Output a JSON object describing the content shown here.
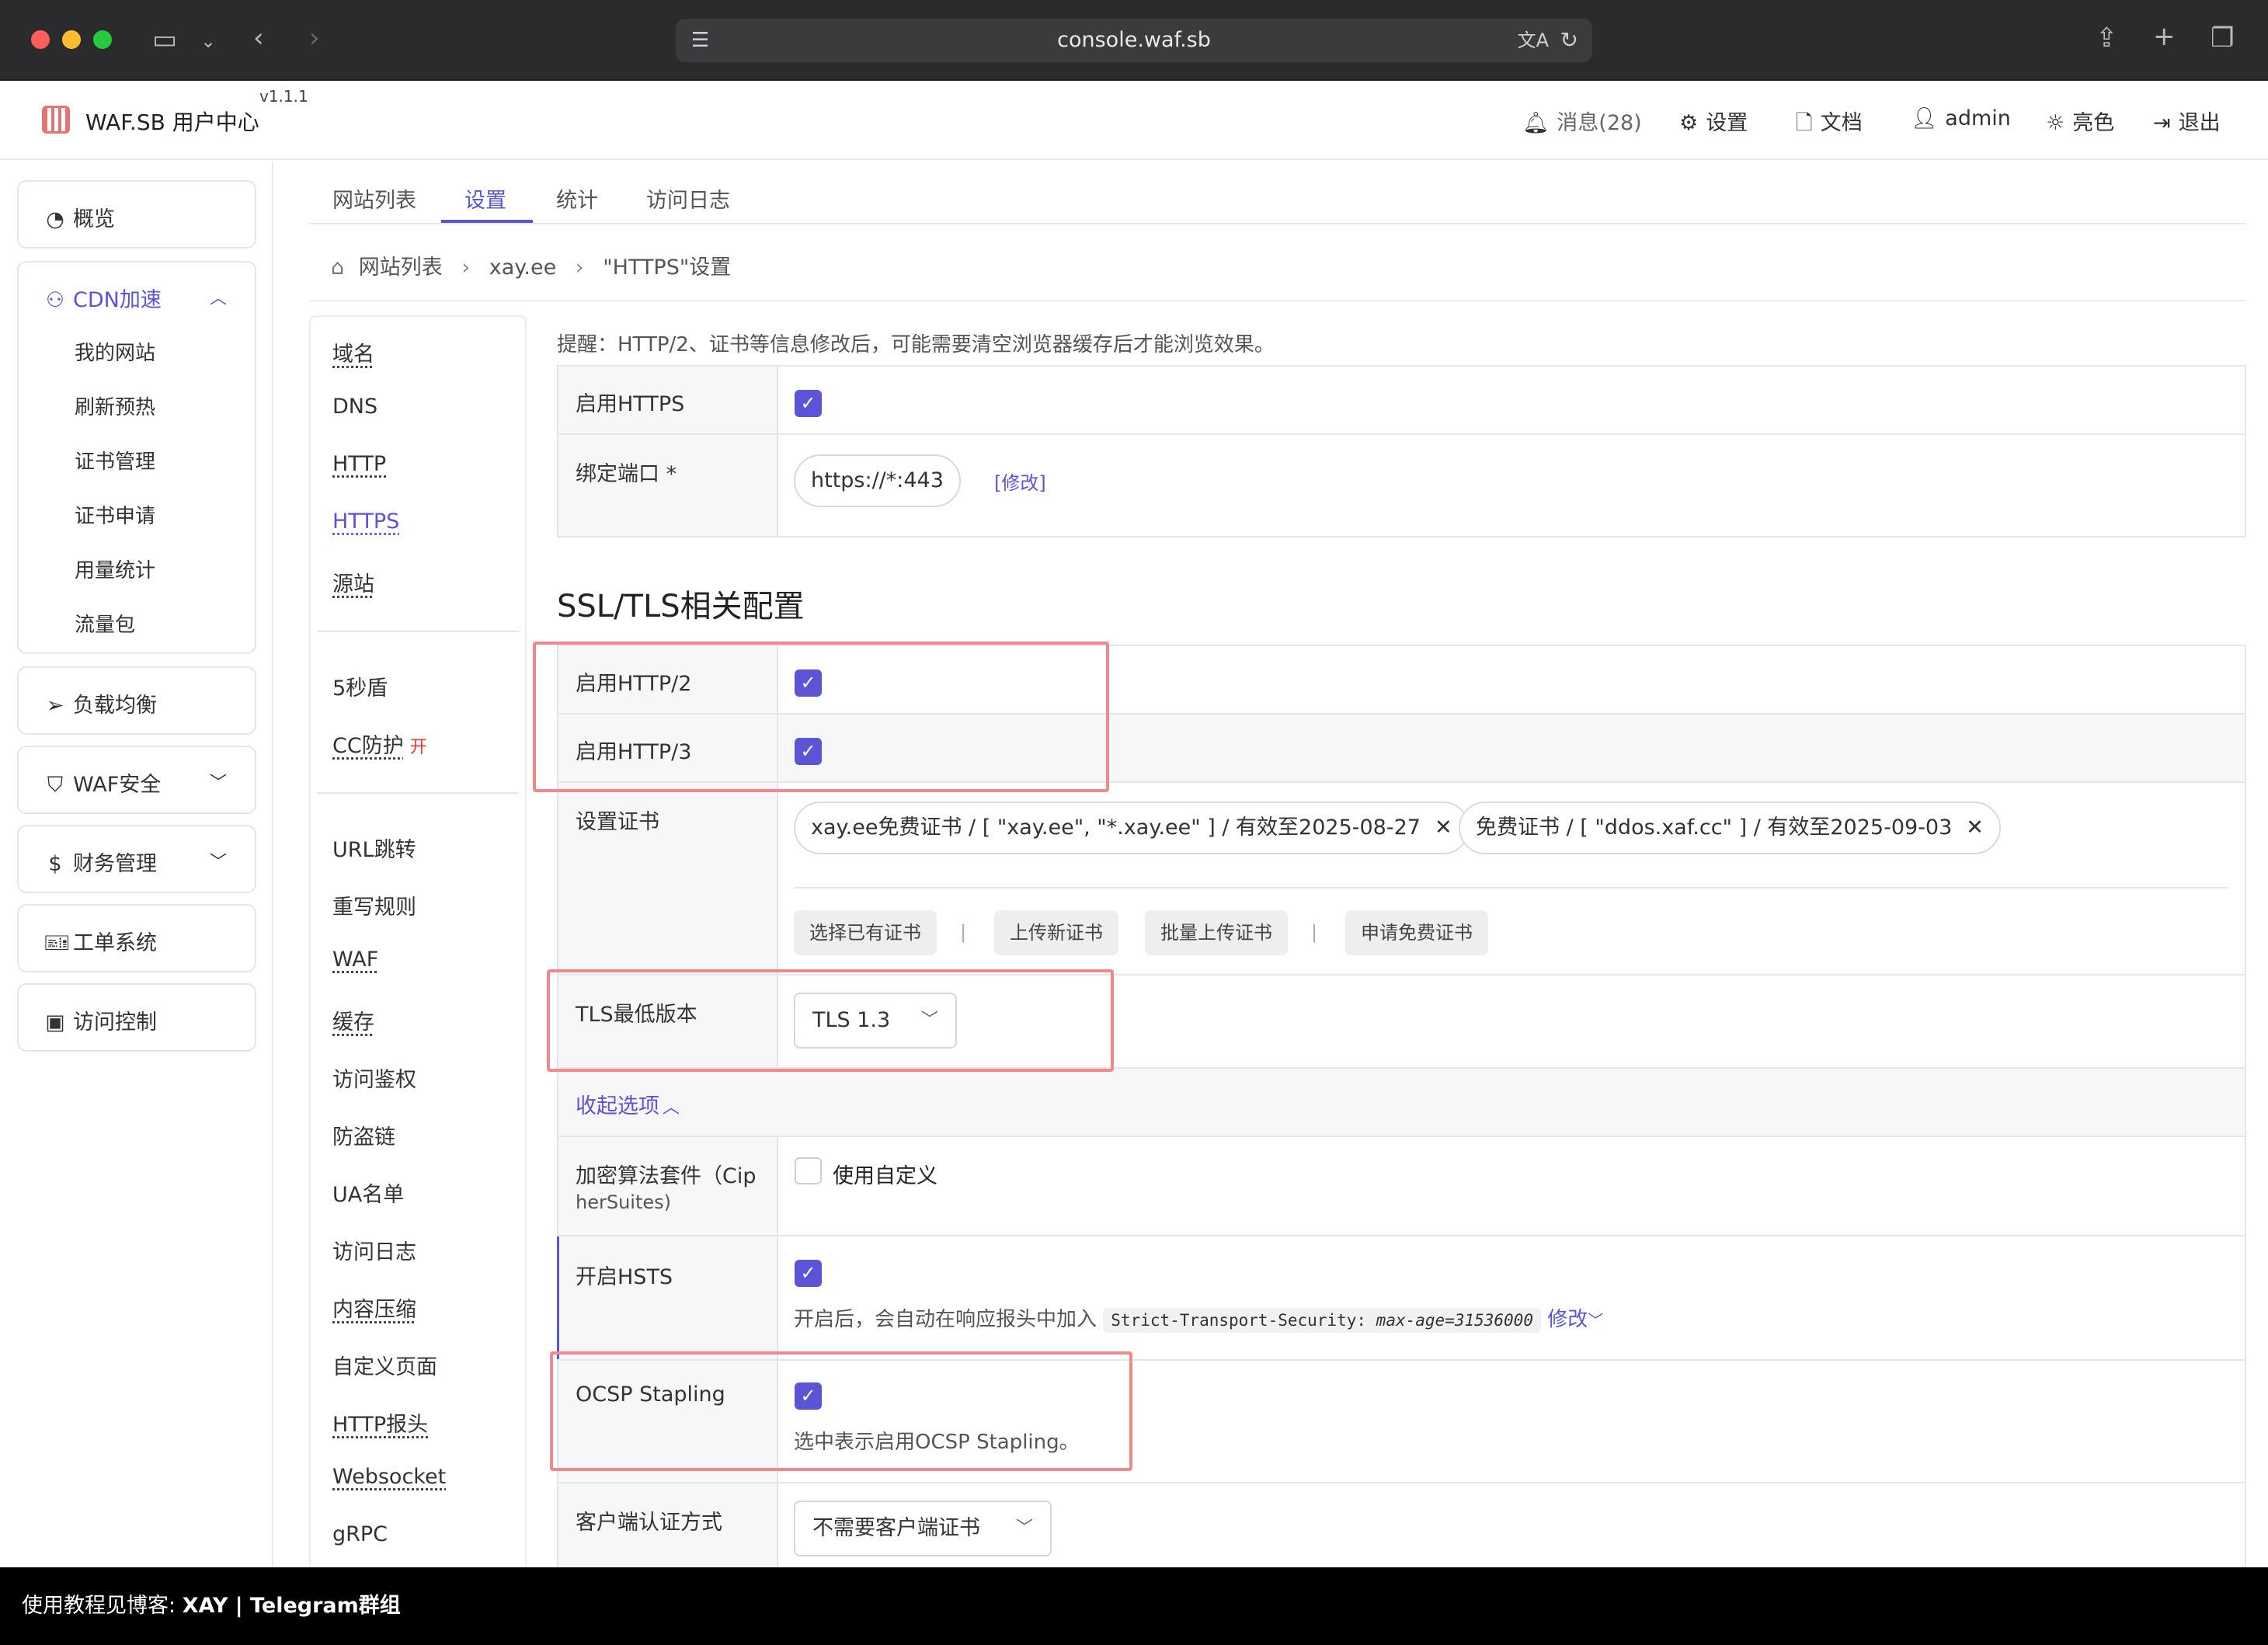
{
  "browser": {
    "url": "console.waf.sb"
  },
  "header": {
    "app_title": "WAF.SB 用户中心",
    "version": "v1.1.1",
    "messages": "消息(28)",
    "settings": "设置",
    "docs": "文档",
    "user": "admin",
    "theme": "亮色",
    "logout": "退出"
  },
  "sidebar": {
    "overview": "概览",
    "cdn": "CDN加速",
    "cdn_items": [
      "我的网站",
      "刷新预热",
      "证书管理",
      "证书申请",
      "用量统计",
      "流量包"
    ],
    "load_balance": "负载均衡",
    "waf": "WAF安全",
    "finance": "财务管理",
    "ticket": "工单系统",
    "access": "访问控制"
  },
  "tabs": [
    "网站列表",
    "设置",
    "统计",
    "访问日志"
  ],
  "breadcrumb": [
    "网站列表",
    "xay.ee",
    "\"HTTPS\"设置"
  ],
  "subnav": {
    "group1": [
      "域名",
      "DNS",
      "HTTP",
      "HTTPS",
      "源站"
    ],
    "group2_a": "5秒盾",
    "group2_b": "CC防护",
    "cc_tag": "开",
    "group3": [
      "URL跳转",
      "重写规则",
      "WAF",
      "缓存",
      "访问鉴权",
      "防盗链",
      "UA名单",
      "访问日志",
      "内容压缩",
      "自定义页面",
      "HTTP报头",
      "Websocket",
      "gRPC"
    ]
  },
  "notice": "提醒：HTTP/2、证书等信息修改后，可能需要清空浏览器缓存后才能浏览效果。",
  "https": {
    "enable_label": "启用HTTPS",
    "port_label": "绑定端口 *",
    "port_value": "https://*:443",
    "port_edit": "[修改]"
  },
  "ssl": {
    "title": "SSL/TLS相关配置",
    "http2_label": "启用HTTP/2",
    "http3_label": "启用HTTP/3",
    "cert_label": "设置证书",
    "cert1": "xay.ee免费证书 / [ \"xay.ee\", \"*.xay.ee\" ] / 有效至2025-08-27",
    "cert2": "免费证书 / [ \"ddos.xaf.cc\" ] / 有效至2025-09-03",
    "btn_select": "选择已有证书",
    "btn_upload": "上传新证书",
    "btn_batch": "批量上传证书",
    "btn_apply": "申请免费证书",
    "tls_label": "TLS最低版本",
    "tls_value": "TLS 1.3",
    "collapse": "收起选项",
    "cipher_label_1": "加密算法套件（Cip",
    "cipher_label_2": "herSuites)",
    "cipher_custom": "使用自定义",
    "hsts_label": "开启HSTS",
    "hsts_hint": "开启后，会自动在响应报头中加入",
    "hsts_code_key": "Strict-Transport-Security:",
    "hsts_code_val": "max-age=31536000",
    "hsts_edit": "修改",
    "ocsp_label": "OCSP Stapling",
    "ocsp_hint": "选中表示启用OCSP Stapling。",
    "client_label": "客户端认证方式",
    "client_value": "不需要客户端证书"
  },
  "footer": {
    "prefix": "使用教程见博客: ",
    "blog": "XAY",
    "sep": " | ",
    "group": "Telegram群组"
  },
  "colors": {
    "accent": "#5b54d6",
    "highlight_box": "#f08a8a",
    "danger": "#e53935"
  }
}
